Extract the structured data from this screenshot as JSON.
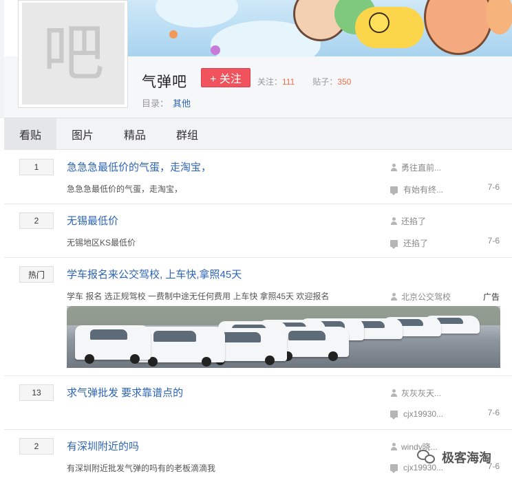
{
  "forum": {
    "avatar_char": "吧",
    "name": "气弹吧",
    "follow_label": "+ 关注",
    "follow_count_label": "关注：",
    "follow_count": "111",
    "post_count_label": "贴子：",
    "post_count": "350",
    "catalog_label": "目录：",
    "catalog_value": "其他"
  },
  "tabs": [
    {
      "label": "看贴",
      "active": true
    },
    {
      "label": "图片",
      "active": false
    },
    {
      "label": "精品",
      "active": false
    },
    {
      "label": "群组",
      "active": false
    }
  ],
  "threads": [
    {
      "count": "1",
      "title": "急急急最低价的气蛋，走淘宝，",
      "abstract": "急急急最低价的气蛋，走淘宝，",
      "author": "勇往直前...",
      "last_reply": "有始有终...",
      "date": "7-6"
    },
    {
      "count": "2",
      "title": "无锡最低价",
      "abstract": "无锡地区KS最低价",
      "author": "还掐了",
      "last_reply": "还掐了",
      "date": "7-6"
    },
    {
      "count": "热门",
      "title": "学车报名来公交驾校, 上车快,拿照45天",
      "abstract": "学车 报名 选正规驾校 一费制中途无任何费用 上车快 拿照45天 欢迎报名",
      "author": "北京公交驾校",
      "tag": "广告"
    },
    {
      "count": "13",
      "title": "求气弹批发 要求靠谱点的",
      "abstract": "",
      "author": "灰灰灰天...",
      "last_reply": "cjx19930...",
      "date": "7-6"
    },
    {
      "count": "2",
      "title": "有深圳附近的吗",
      "abstract": "有深圳附近批发气弹的吗有的老板滴滴我",
      "author": "windy晓...",
      "last_reply": "cjx19930...",
      "date": "7-6"
    }
  ],
  "watermark": {
    "text": "极客海淘"
  },
  "colors": {
    "accent": "#2d64b3",
    "follow": "#f0535d",
    "stat_number": "#f06a48"
  }
}
